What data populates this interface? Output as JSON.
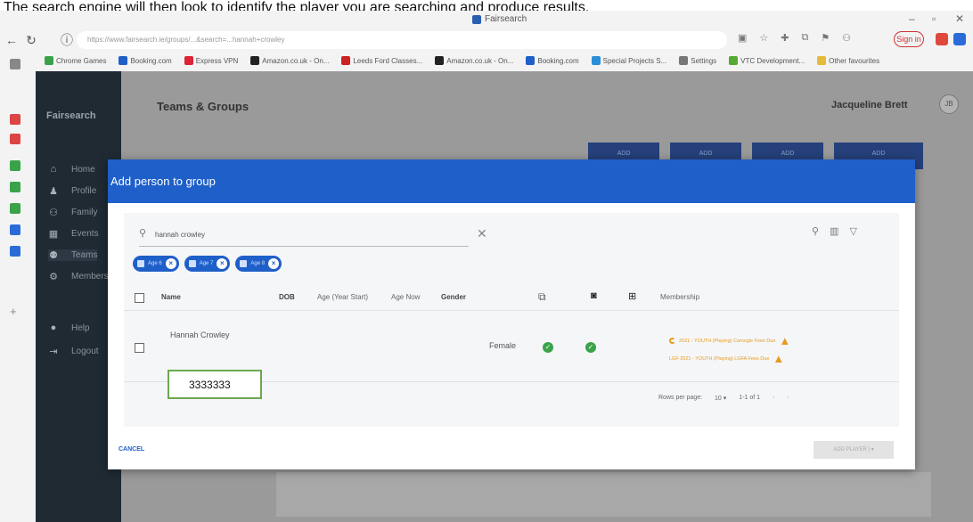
{
  "caption": "The search engine will then look to identify the player you are searching and produce results.",
  "browser": {
    "tab_title": "Fairsearch",
    "url": "https://www.fairsearch.ie/groups/...&search=...hannah+crowley",
    "sign_in": "Sign in",
    "bookmarks": [
      "Chrome Games",
      "Booking.com",
      "Express VPN",
      "Amazon.co.uk - On...",
      "Leeds Ford Classes...",
      "Amazon.co.uk - On...",
      "Booking.com",
      "Special Projects S...",
      "Settings",
      "VTC Development...",
      "Other favourites"
    ]
  },
  "app": {
    "brand": "Fairsearch",
    "page_title": "Teams & Groups",
    "user_name": "Jacqueline Brett",
    "user_initials": "JB",
    "sidebar": [
      {
        "icon": "home-icon",
        "glyph": "⌂",
        "label": "Home"
      },
      {
        "icon": "profile-icon",
        "glyph": "♟",
        "label": "Profile"
      },
      {
        "icon": "family-icon",
        "glyph": "⚇",
        "label": "Family"
      },
      {
        "icon": "events-icon",
        "glyph": "▦",
        "label": "Events"
      },
      {
        "icon": "teams-icon",
        "glyph": "⚉",
        "label": "Teams"
      },
      {
        "icon": "members-icon",
        "glyph": "⚙",
        "label": "Members"
      },
      {
        "icon": "help-icon",
        "glyph": "●",
        "label": "Help"
      },
      {
        "icon": "logout-icon",
        "glyph": "⇥",
        "label": "Logout"
      }
    ],
    "bg_buttons": [
      "ADD",
      "ADD",
      "ADD",
      "ADD"
    ]
  },
  "modal": {
    "title": "Add person to group",
    "search_value": "hannah crowley",
    "chips": [
      "Age 6",
      "Age 7",
      "Age 8"
    ],
    "columns": [
      "Name",
      "DOB",
      "Age (Year Start)",
      "Age Now",
      "Gender",
      "Membership"
    ],
    "rows": [
      {
        "name": "Hannah Crowley",
        "gender": "Female",
        "memberships": [
          "2021 - YOUTH (Playing) Camogie Fees Due",
          "LGF 2021 - YOUTH (Playing) LGFA Fees Due"
        ]
      }
    ],
    "callout_value": "3333333",
    "rows_per_page_label": "Rows per page:",
    "rows_per_page_value": "10",
    "page_range": "1-1 of 1",
    "cancel_label": "CANCEL",
    "add_label": "ADD PLAYER"
  },
  "colors": {
    "primary": "#1f5fc9",
    "warning": "#e89a1c",
    "success": "#3aa34a",
    "sidebar": "#1f2a33",
    "callout_border": "#6aa84f"
  }
}
